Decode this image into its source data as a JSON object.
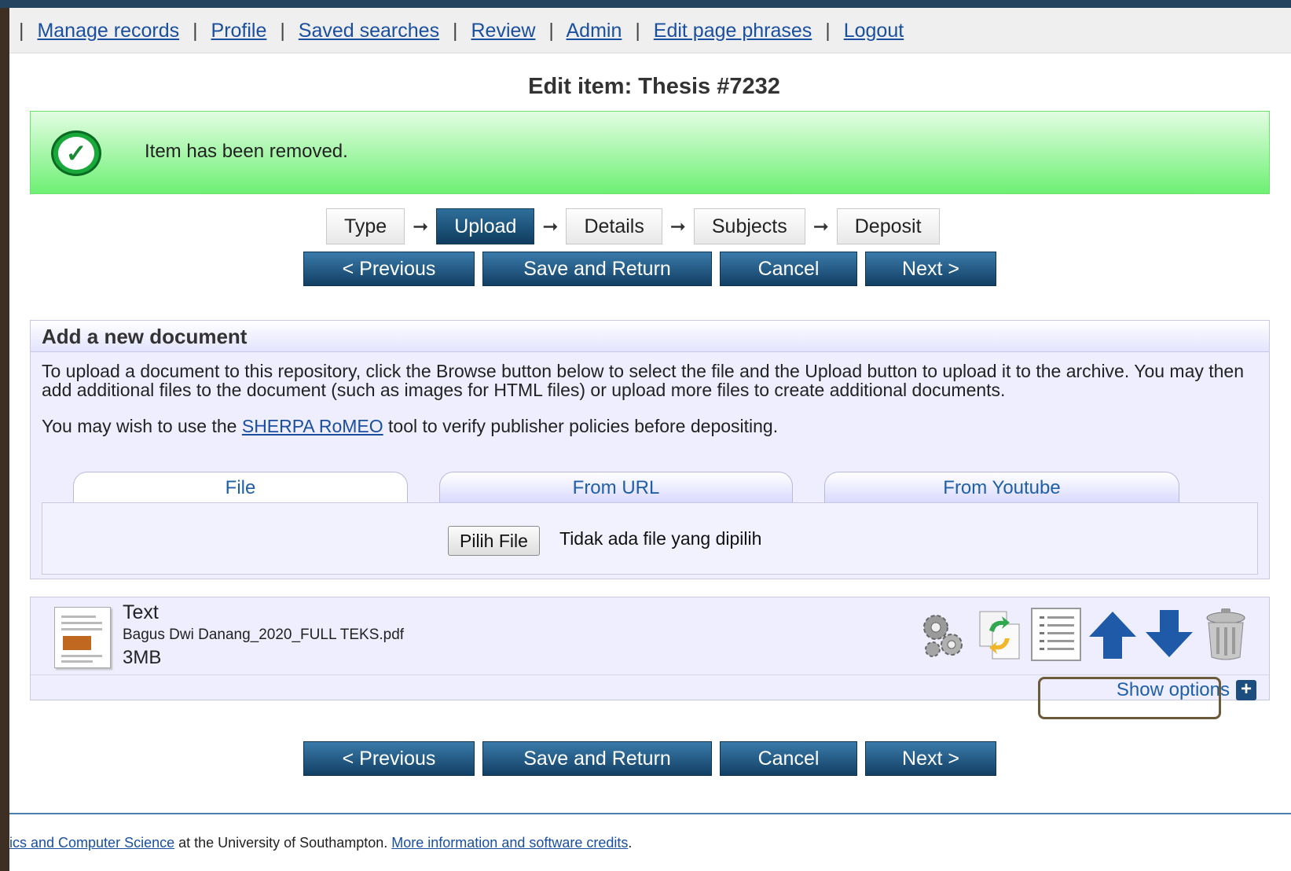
{
  "nav": {
    "items": [
      "Manage records",
      "Profile",
      "Saved searches",
      "Review",
      "Admin",
      "Edit page phrases",
      "Logout"
    ]
  },
  "page_title": "Edit item: Thesis #7232",
  "message": {
    "text": "Item has been removed."
  },
  "workflow_steps": [
    "Type",
    "Upload",
    "Details",
    "Subjects",
    "Deposit"
  ],
  "active_step": "Upload",
  "buttons": {
    "previous": "< Previous",
    "save_return": "Save and Return",
    "cancel": "Cancel",
    "next": "Next >"
  },
  "add_document": {
    "heading": "Add a new document",
    "intro": "To upload a document to this repository, click the Browse button below to select the file and the Upload button to upload it to the archive. You may then add additional files to the document (such as images for HTML files) or upload more files to create additional documents.",
    "sherpa_prefix": "You may wish to use the ",
    "sherpa_link": "SHERPA RoMEO",
    "sherpa_suffix": " tool to verify publisher policies before depositing.",
    "tabs": [
      "File",
      "From URL",
      "From Youtube"
    ],
    "file_button": "Pilih File",
    "file_status": "Tidak ada file yang dipilih"
  },
  "document": {
    "type": "Text",
    "filename": "Bagus Dwi Danang_2020_FULL TEKS.pdf",
    "size": "3MB",
    "actions": [
      "gears-icon",
      "convert-icon",
      "list-icon",
      "arrow-up-icon",
      "arrow-down-icon",
      "trash-icon"
    ],
    "show_options": "Show options"
  },
  "footer": {
    "link1": "ics and Computer Science",
    "middle": " at the University of Southampton. ",
    "link2": "More information and software credits",
    "end": "."
  },
  "colors": {
    "nav_link": "#1a4fa0",
    "button_dark": "#123f63",
    "message_green": "#6ef074"
  }
}
